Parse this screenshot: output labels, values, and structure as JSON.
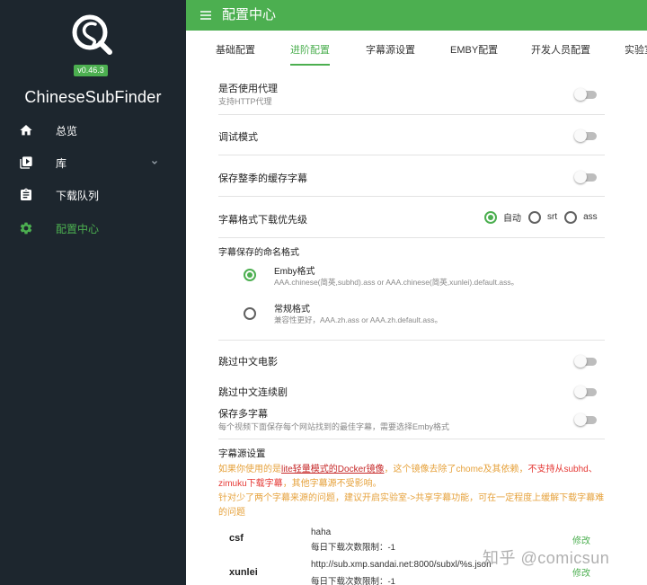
{
  "sidebar": {
    "version": "v0.46.3",
    "app_name": "ChineseSubFinder",
    "items": [
      {
        "label": "总览",
        "icon": "home-icon"
      },
      {
        "label": "库",
        "icon": "video-library-icon"
      },
      {
        "label": "下载队列",
        "icon": "clipboard-list-icon"
      },
      {
        "label": "配置中心",
        "icon": "gear-icon"
      }
    ]
  },
  "header": {
    "title": "配置中心"
  },
  "tabs": [
    {
      "label": "基础配置"
    },
    {
      "label": "进阶配置",
      "active": true
    },
    {
      "label": "字幕源设置"
    },
    {
      "label": "EMBY配置"
    },
    {
      "label": "开发人员配置"
    },
    {
      "label": "实验室"
    }
  ],
  "settings": {
    "proxy": {
      "label": "是否使用代理",
      "sub": "支持HTTP代理",
      "on": false
    },
    "debug": {
      "label": "调试模式",
      "on": false
    },
    "season_cache": {
      "label": "保存整季的缓存字幕",
      "on": false
    },
    "format_priority": {
      "label": "字幕格式下载优先级",
      "options": [
        "自动",
        "srt",
        "ass"
      ],
      "selected": "自动"
    },
    "naming": {
      "label": "字幕保存的命名格式",
      "options": [
        {
          "title": "Emby格式",
          "desc": "AAA.chinese(简英,subhd).ass or AAA.chinese(简英,xunlei).default.ass。",
          "checked": true
        },
        {
          "title": "常规格式",
          "desc": "兼容性更好，AAA.zh.ass or AAA.zh.default.ass。",
          "checked": false
        }
      ]
    },
    "skip_cn_movie": {
      "label": "跳过中文电影",
      "on": false
    },
    "skip_cn_series": {
      "label": "跳过中文连续剧",
      "on": false
    },
    "save_multi": {
      "label": "保存多字幕",
      "sub": "每个视频下面保存每个网站找到的最佳字幕，需要选择Emby格式",
      "on": false
    }
  },
  "subtitle_sources": {
    "title": "字幕源设置",
    "notice": {
      "p1": "如果你使用的是",
      "link": "lite轻量模式的Docker镜像",
      "p2": "，这个镜像去除了chome及其依赖，",
      "p3": "不支持从subhd、zimuku下载字幕",
      "p4": "，其他字幕源不受影响。"
    },
    "tip": "针对少了两个字幕来源的问题，建议开启实验室->共享字幕功能，可在一定程度上缓解下载字幕难的问题",
    "sources": [
      {
        "name": "csf",
        "value": "haha",
        "limit": "每日下载次数限制：-1",
        "edit": "修改"
      },
      {
        "name": "xunlei",
        "value": "http://sub.xmp.sandai.net:8000/subxl/%s.json",
        "limit": "每日下载次数限制：-1",
        "edit": "修改"
      }
    ]
  },
  "watermark": "知乎 @comicsun",
  "colors": {
    "accent": "#4caf50",
    "sidebar_bg": "#1d262e",
    "warn": "#e6a23c",
    "danger": "#e53935"
  }
}
